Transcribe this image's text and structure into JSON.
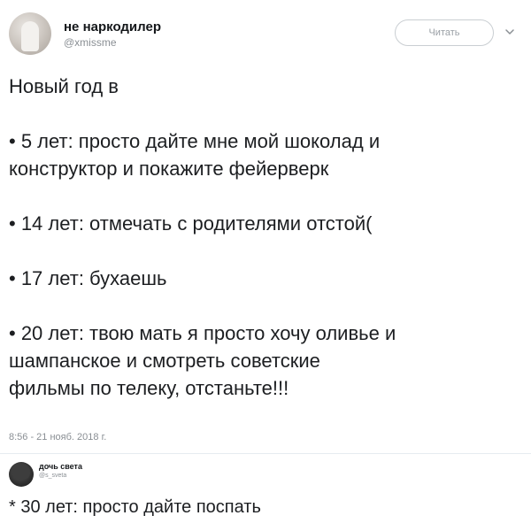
{
  "tweet": {
    "author_name": "не наркодилер",
    "author_handle": "@xmissme",
    "follow_label": "Читать",
    "lines": [
      "Новый год в",
      "",
      "• 5 лет: просто дайте мне мой шоколад и",
      "конструктор и покажите фейерверк",
      "",
      "• 14 лет: отмечать с родителями отстой(",
      "",
      "• 17 лет: бухаешь",
      "",
      "• 20 лет: твою мать я просто хочу оливье и",
      "шампанское и смотреть советские",
      "фильмы по телеку, отстаньте!!!"
    ],
    "timestamp": "8:56 - 21 нояб. 2018 г."
  },
  "reply": {
    "author_name": "дочь света",
    "author_handle": "@s_sveta",
    "text": "* 30 лет: просто дайте поспать"
  },
  "icons": {
    "chevron": "chevron-down-icon"
  },
  "colors": {
    "text": "#1c1e21",
    "muted": "#8a8f94",
    "border": "#c9ced2"
  }
}
